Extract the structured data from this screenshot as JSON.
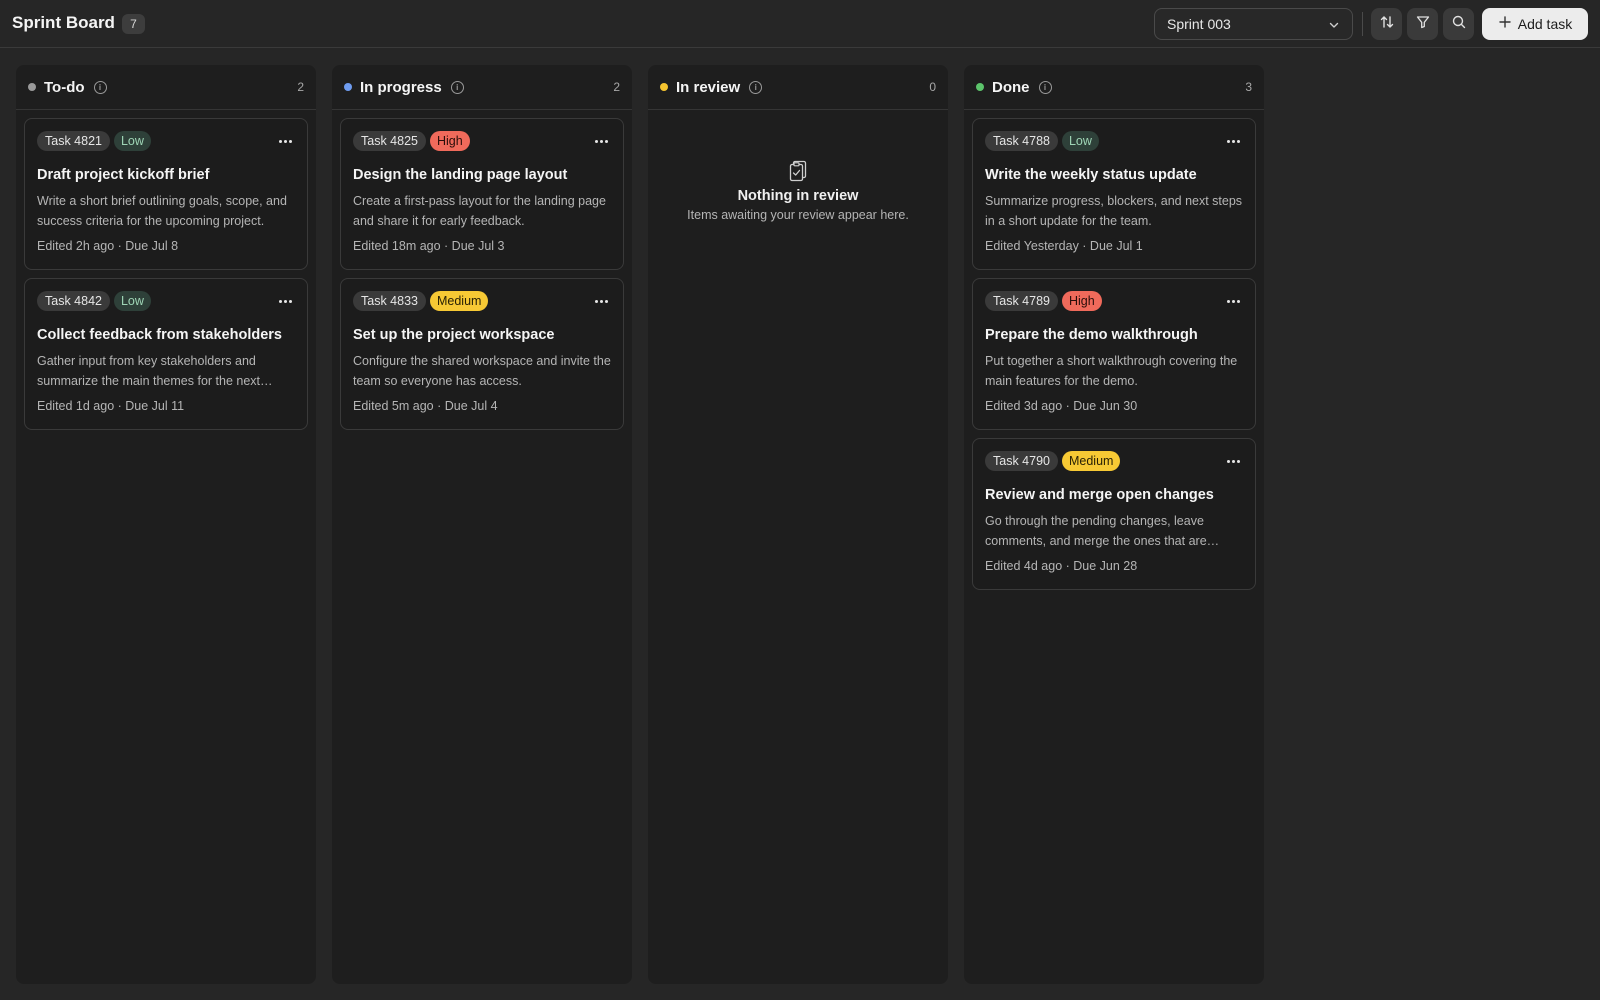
{
  "header": {
    "title": "Sprint Board",
    "count": "7",
    "sprint_selected": "Sprint 003",
    "add_label": "Add task"
  },
  "colors": {
    "todo": "#9a9a9a",
    "in_progress": "#6f9cf0",
    "in_review": "#f5c42f",
    "done": "#5cc46b"
  },
  "columns": [
    {
      "title": "To-do",
      "count": "2",
      "cards": [
        {
          "id": "Task 4821",
          "priority": "Low",
          "title": "Draft project kickoff brief",
          "desc": "Write a short brief outlining goals, scope, and success criteria for the upcoming project.",
          "meta": "Edited 2h ago · Due Jul 8"
        },
        {
          "id": "Task 4842",
          "priority": "Low",
          "title": "Collect feedback from stakeholders",
          "desc": "Gather input from key stakeholders and summarize the main themes for the next…",
          "meta": "Edited 1d ago · Due Jul 11"
        }
      ]
    },
    {
      "title": "In progress",
      "count": "2",
      "cards": [
        {
          "id": "Task 4825",
          "priority": "High",
          "title": "Design the landing page layout",
          "desc": "Create a first-pass layout for the landing page and share it for early feedback.",
          "meta": "Edited 18m ago · Due Jul 3"
        },
        {
          "id": "Task 4833",
          "priority": "Medium",
          "title": "Set up the project workspace",
          "desc": "Configure the shared workspace and invite the team so everyone has access.",
          "meta": "Edited 5m ago · Due Jul 4"
        }
      ]
    },
    {
      "title": "In review",
      "count": "0",
      "empty_title": "Nothing in review",
      "empty_sub": "Items awaiting your review appear here.",
      "cards": []
    },
    {
      "title": "Done",
      "count": "3",
      "cards": [
        {
          "id": "Task 4788",
          "priority": "Low",
          "title": "Write the weekly status update",
          "desc": "Summarize progress, blockers, and next steps in a short update for the team.",
          "meta": "Edited Yesterday · Due Jul 1"
        },
        {
          "id": "Task 4789",
          "priority": "High",
          "title": "Prepare the demo walkthrough",
          "desc": "Put together a short walkthrough covering the main features for the demo.",
          "meta": "Edited 3d ago · Due Jun 30"
        },
        {
          "id": "Task 4790",
          "priority": "Medium",
          "title": "Review and merge open changes",
          "desc": "Go through the pending changes, leave comments, and merge the ones that are…",
          "meta": "Edited 4d ago · Due Jun 28"
        }
      ]
    }
  ]
}
